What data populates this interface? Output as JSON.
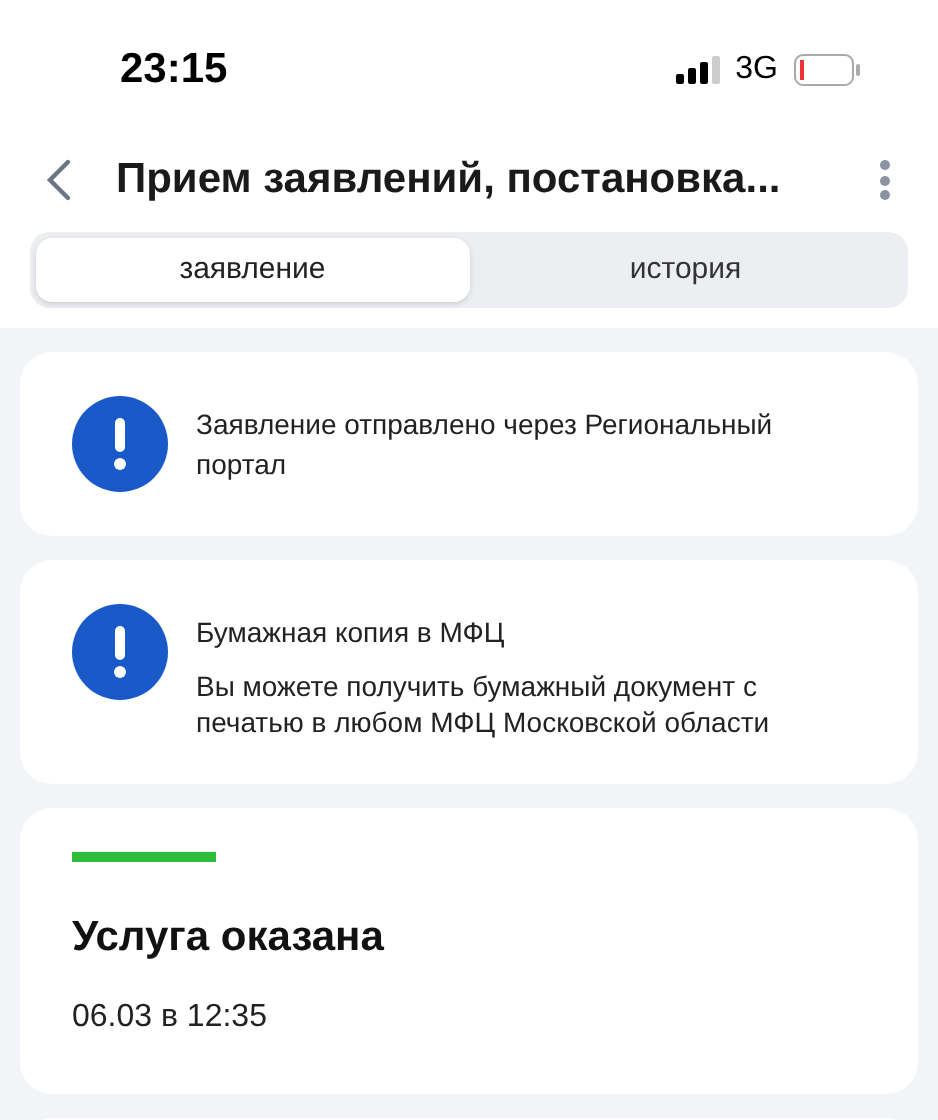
{
  "status_bar": {
    "time": "23:15",
    "network": "3G"
  },
  "header": {
    "title": "Прием заявлений, постановка..."
  },
  "tabs": [
    {
      "label": "заявление",
      "selected": true
    },
    {
      "label": "история",
      "selected": false
    }
  ],
  "notices": [
    {
      "title": "Заявление отправлено через Региональный портал"
    },
    {
      "title": "Бумажная копия в МФЦ",
      "text": "Вы можете получить бумажный документ с печатью в любом МФЦ Московской области"
    }
  ],
  "status_card": {
    "color": "#2fbe3c",
    "title": "Услуга оказана",
    "date": "06.03 в 12:35"
  }
}
